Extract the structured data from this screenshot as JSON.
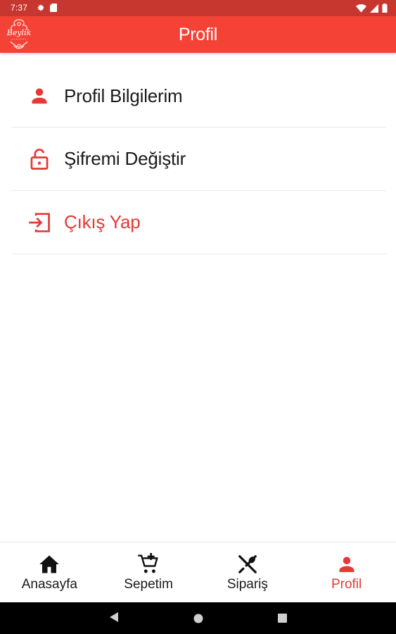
{
  "status_bar": {
    "time": "7:37",
    "left_icons": [
      "gear-icon",
      "sd-card-icon"
    ],
    "right_icons": [
      "wifi-icon",
      "signal-icon",
      "battery-icon"
    ]
  },
  "app_bar": {
    "title": "Profil",
    "logo_text": "Beylik",
    "background": "#f44336"
  },
  "menu": {
    "items": [
      {
        "label": "Profil Bilgilerim",
        "icon": "person-icon"
      },
      {
        "label": "Şifremi Değiştir",
        "icon": "lock-icon"
      },
      {
        "label": "Çıkış Yap",
        "icon": "logout-icon"
      }
    ]
  },
  "bottom_nav": {
    "items": [
      {
        "label": "Anasayfa",
        "icon": "home-icon",
        "active": false
      },
      {
        "label": "Sepetim",
        "icon": "cart-add-icon",
        "active": false
      },
      {
        "label": "Sipariş",
        "icon": "utensils-icon",
        "active": false
      },
      {
        "label": "Profil",
        "icon": "person-icon",
        "active": true
      }
    ]
  },
  "colors": {
    "accent": "#e53935",
    "status_bar": "#c7372f",
    "text": "#1a1a1a"
  }
}
